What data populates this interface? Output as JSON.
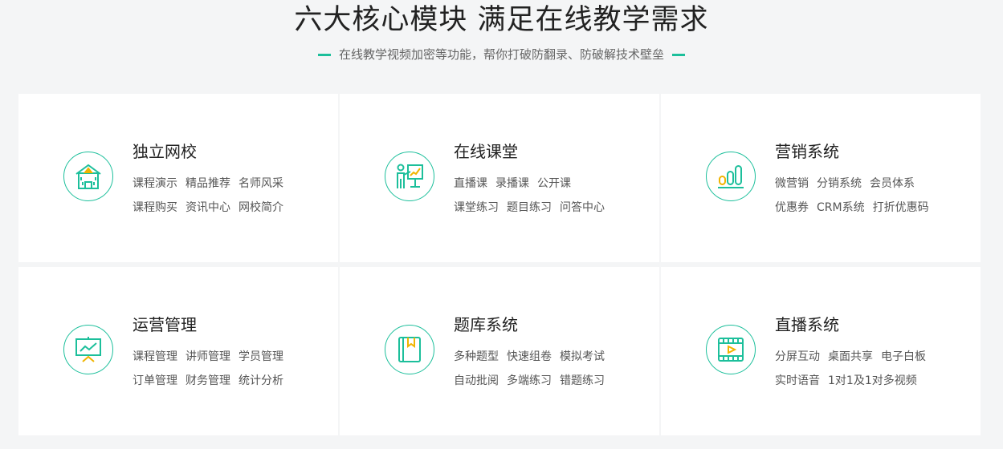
{
  "header": {
    "title": "六大核心模块 满足在线教学需求",
    "subtitle": "在线教学视频加密等功能，帮你打破防翻录、防破解技术壁垒"
  },
  "colors": {
    "accent": "#1cbf9b",
    "highlight": "#f0b400"
  },
  "modules": [
    {
      "icon": "school-building-icon",
      "title": "独立网校",
      "features": [
        [
          "课程演示",
          "精品推荐",
          "名师风采"
        ],
        [
          "课程购买",
          "资讯中心",
          "网校简介"
        ]
      ]
    },
    {
      "icon": "teacher-board-icon",
      "title": "在线课堂",
      "features": [
        [
          "直播课",
          "录播课",
          "公开课"
        ],
        [
          "课堂练习",
          "题目练习",
          "问答中心"
        ]
      ]
    },
    {
      "icon": "bar-chart-icon",
      "title": "营销系统",
      "features": [
        [
          "微营销",
          "分销系统",
          "会员体系"
        ],
        [
          "优惠券",
          "CRM系统",
          "打折优惠码"
        ]
      ]
    },
    {
      "icon": "presentation-board-icon",
      "title": "运营管理",
      "features": [
        [
          "课程管理",
          "讲师管理",
          "学员管理"
        ],
        [
          "订单管理",
          "财务管理",
          "统计分析"
        ]
      ]
    },
    {
      "icon": "bookmark-book-icon",
      "title": "题库系统",
      "features": [
        [
          "多种题型",
          "快速组卷",
          "模拟考试"
        ],
        [
          "自动批阅",
          "多端练习",
          "错题练习"
        ]
      ]
    },
    {
      "icon": "video-film-icon",
      "title": "直播系统",
      "features": [
        [
          "分屏互动",
          "桌面共享",
          "电子白板"
        ],
        [
          "实时语音",
          "1对1及1对多视频"
        ]
      ]
    }
  ]
}
